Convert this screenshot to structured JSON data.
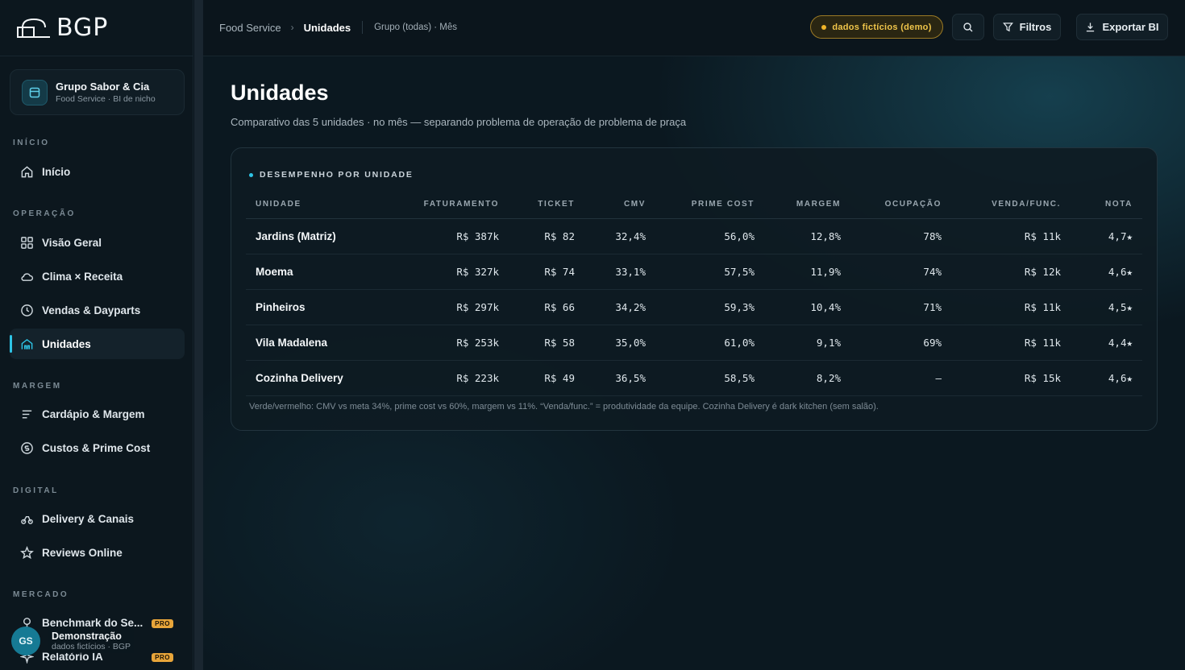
{
  "brand": {
    "logo_text": "BGP"
  },
  "org": {
    "name": "Grupo Sabor & Cia",
    "sub": "Food Service · BI de nicho"
  },
  "nav": {
    "sections": {
      "inicio": "INÍCIO",
      "operacao": "OPERAÇÃO",
      "margem": "MARGEM",
      "digital": "DIGITAL",
      "mercado": "MERCADO"
    },
    "items": {
      "inicio": "Início",
      "visao_geral": "Visão Geral",
      "clima": "Clima × Receita",
      "vendas": "Vendas & Dayparts",
      "unidades": "Unidades",
      "cardapio": "Cardápio & Margem",
      "custos": "Custos & Prime Cost",
      "delivery": "Delivery & Canais",
      "reviews": "Reviews Online",
      "benchmark": "Benchmark do Se...",
      "relatorio": "Relatório IA"
    },
    "pro_label": "PRO",
    "active": "unidades"
  },
  "user": {
    "initials": "GS",
    "name": "Demonstração",
    "sub": "dados fictícios · BGP"
  },
  "topbar": {
    "breadcrumb_root": "Food Service",
    "breadcrumb_current": "Unidades",
    "context": "Grupo (todas) · Mês",
    "demo_label": "dados fictícios (demo)",
    "filters_label": "Filtros",
    "export_label": "Exportar BI"
  },
  "page": {
    "title": "Unidades",
    "subtitle": "Comparativo das 5 unidades · no mês — separando problema de operação de problema de praça"
  },
  "table": {
    "title": "DESEMPENHO POR UNIDADE",
    "columns": [
      "UNIDADE",
      "FATURAMENTO",
      "TICKET",
      "CMV",
      "PRIME COST",
      "MARGEM",
      "OCUPAÇÃO",
      "VENDA/FUNC.",
      "NOTA"
    ],
    "rows": [
      [
        "Jardins (Matriz)",
        "R$ 387k",
        "R$ 82",
        "32,4%",
        "56,0%",
        "12,8%",
        "78%",
        "R$ 11k",
        "4,7★"
      ],
      [
        "Moema",
        "R$ 327k",
        "R$ 74",
        "33,1%",
        "57,5%",
        "11,9%",
        "74%",
        "R$ 12k",
        "4,6★"
      ],
      [
        "Pinheiros",
        "R$ 297k",
        "R$ 66",
        "34,2%",
        "59,3%",
        "10,4%",
        "71%",
        "R$ 11k",
        "4,5★"
      ],
      [
        "Vila Madalena",
        "R$ 253k",
        "R$ 58",
        "35,0%",
        "61,0%",
        "9,1%",
        "69%",
        "R$ 11k",
        "4,4★"
      ],
      [
        "Cozinha Delivery",
        "R$ 223k",
        "R$ 49",
        "36,5%",
        "58,5%",
        "8,2%",
        "—",
        "R$ 15k",
        "4,6★"
      ]
    ],
    "footnote": "Verde/vermelho: CMV vs meta 34%, prime cost vs 60%, margem vs 11%. “Venda/func.” = produtividade da equipe. Cozinha Delivery é dark kitchen (sem salão)."
  },
  "colors": {
    "accent": "#2ec4e6",
    "demo": "#f0c54a",
    "pro": "#e8a53a"
  }
}
